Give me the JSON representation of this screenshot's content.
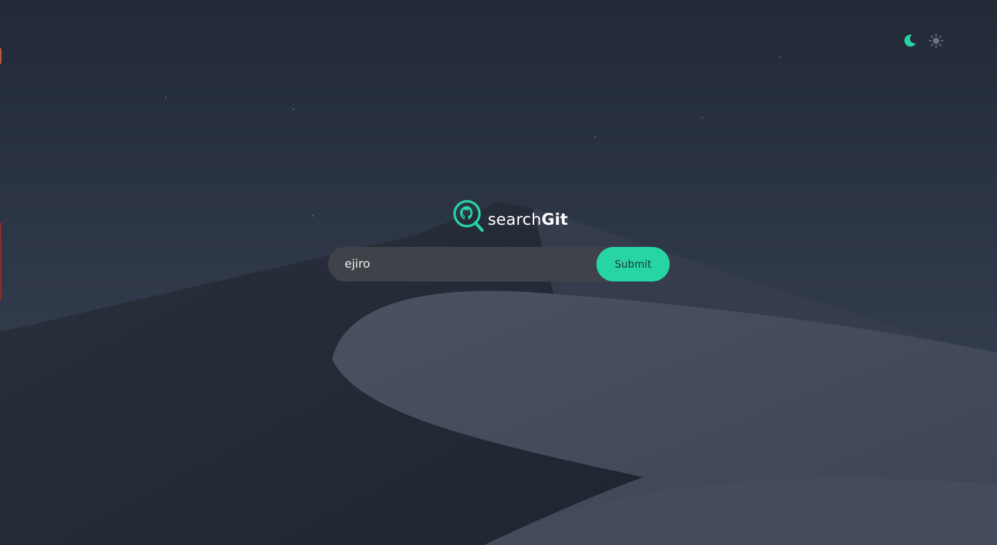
{
  "theme": {
    "accent": "#27d4a4",
    "background": "#283040",
    "icons": [
      "moon-icon",
      "sun-icon"
    ]
  },
  "logo": {
    "icon": "github-search-icon",
    "text_light": "search",
    "text_bold": "Git"
  },
  "search": {
    "value": "ejiro",
    "placeholder": "",
    "submit_label": "Submit"
  }
}
